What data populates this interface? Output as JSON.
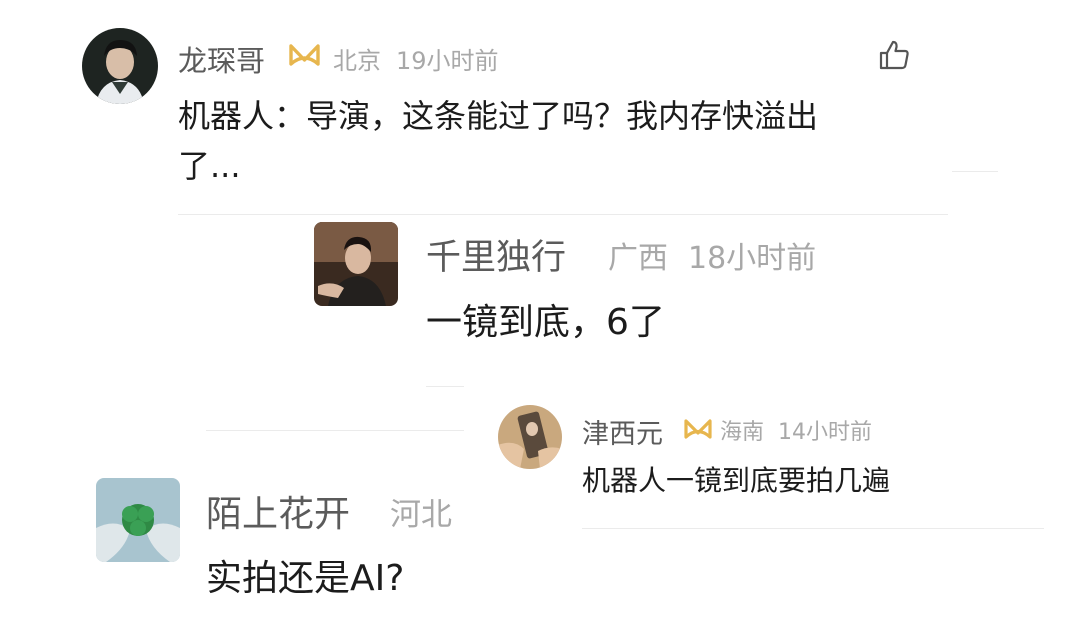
{
  "comments": [
    {
      "username": "龙琛哥",
      "location": "北京",
      "time": "19小时前",
      "text_line1": "机器人：导演，这条能过了吗？我内存快溢出",
      "text_line2": "了...",
      "verified_badge": "gold-ribbon-badge"
    },
    {
      "username": "千里独行",
      "location": "广西",
      "time": "18小时前",
      "text": "一镜到底，6了"
    },
    {
      "username": "津西元",
      "location": "海南",
      "time": "14小时前",
      "text": "机器人一镜到底要拍几遍",
      "verified_badge": "gold-ribbon-badge"
    },
    {
      "username": "陌上花开",
      "location": "河北",
      "text": "实拍还是AI?"
    }
  ],
  "icons": {
    "like": "thumbs-up-icon",
    "badge_color": "#e7b64e"
  }
}
